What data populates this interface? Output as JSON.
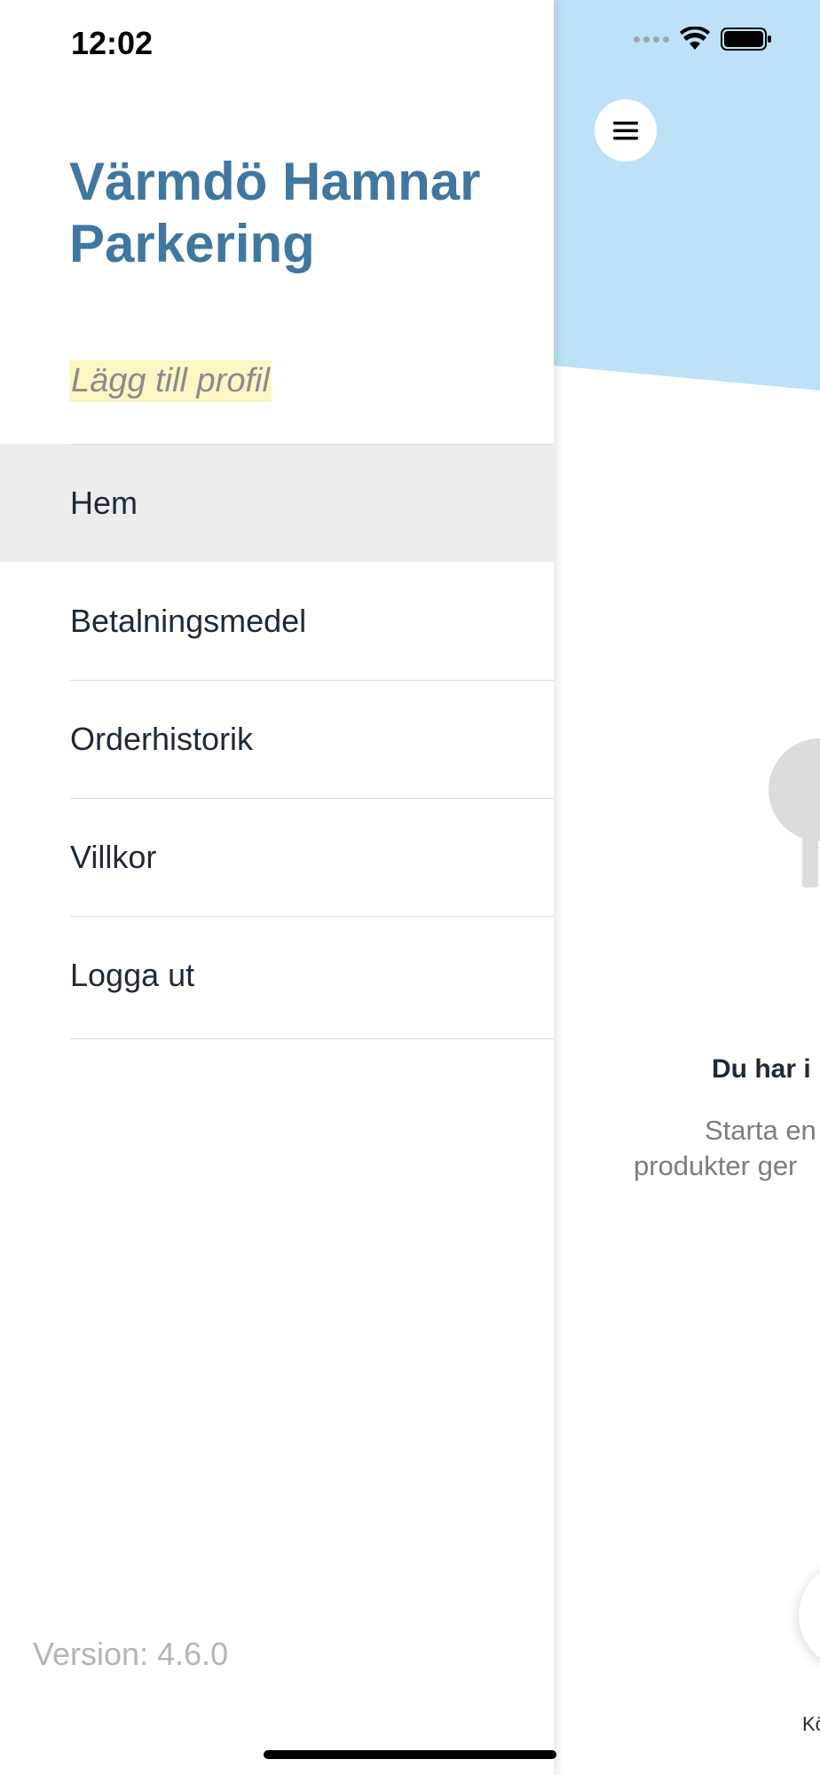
{
  "status_bar": {
    "time": "12:02"
  },
  "drawer": {
    "title": "Värmdö Hamnar Parkering",
    "add_profile": "Lägg till profil",
    "menu": [
      {
        "label": "Hem",
        "active": true
      },
      {
        "label": "Betalningsmedel",
        "active": false
      },
      {
        "label": "Orderhistorik",
        "active": false
      },
      {
        "label": "Villkor",
        "active": false
      },
      {
        "label": "Logga ut",
        "active": false
      }
    ],
    "version": "Version: 4.6.0"
  },
  "main": {
    "header_color": "#bde2f7",
    "empty_title": "Du har i",
    "empty_text_line1": "Starta en n",
    "empty_text_line2": "produkter ger",
    "fab_label": "Kö"
  },
  "colors": {
    "brand_title": "#41779f",
    "highlight": "#fbf6c4",
    "active_row": "#ededed"
  }
}
